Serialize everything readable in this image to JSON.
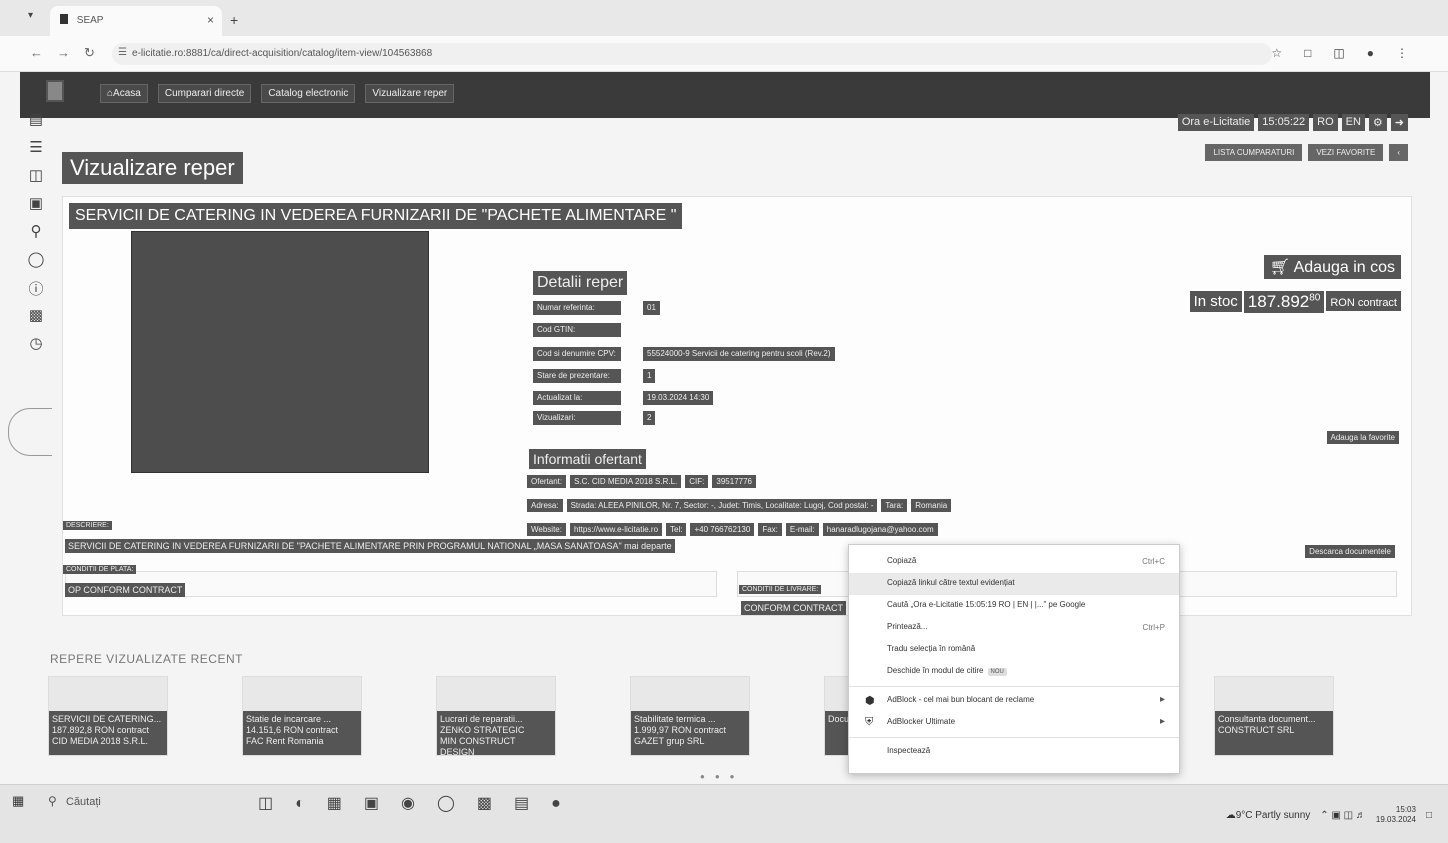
{
  "browser": {
    "tab_title": "SEAP",
    "url": "e-licitatie.ro:8881/ca/direct-acquisition/catalog/item-view/104563868"
  },
  "nav": {
    "crumbs": [
      "Acasa",
      "Cumparari directe",
      "Catalog electronic",
      "Vizualizare reper"
    ]
  },
  "header": {
    "time_label": "Ora e-Licitatie",
    "time_value": "15:05:22",
    "lang_ro": "RO",
    "lang_en": "EN",
    "cart_btn": "LISTA CUMPARATURI",
    "fav_btn": "VEZI FAVORITE"
  },
  "page": {
    "title": "Vizualizare reper"
  },
  "item": {
    "title": "SERVICII DE CATERING IN VEDEREA FURNIZARII DE \"PACHETE ALIMENTARE \"",
    "details_heading": "Detalii reper",
    "details": [
      {
        "label": "Numar referinta:",
        "value": "01"
      },
      {
        "label": "Cod GTIN:",
        "value": ""
      },
      {
        "label": "Cod si denumire CPV:",
        "value": "55524000-9 Servicii de catering pentru scoli (Rev.2)"
      },
      {
        "label": "Stare de prezentare:",
        "value": "1"
      },
      {
        "label": "Actualizat la:",
        "value": "19.03.2024 14:30"
      },
      {
        "label": "Vizualizari:",
        "value": "2"
      }
    ],
    "ofertant_heading": "Informatii ofertant",
    "ofertant": {
      "ofertant_lbl": "Ofertant:",
      "ofertant_val": "S.C. CID MEDIA 2018 S.R.L.",
      "cif_lbl": "CIF:",
      "cif_val": "39517776",
      "adresa_lbl": "Adresa:",
      "adresa_val": "Strada: ALEEA PINILOR, Nr. 7, Sector: -, Judet: Timis, Localitate: Lugoj, Cod postal: -",
      "tara_lbl": "Tara:",
      "tara_val": "Romania",
      "website_lbl": "Website:",
      "website_val": "https://www.e-licitatie.ro",
      "tel_lbl": "Tel:",
      "tel_val": "+40 766762130",
      "fax_lbl": "Fax:",
      "fax_val": "",
      "email_lbl": "E-mail:",
      "email_val": "hanaradlugojana@yahoo.com"
    },
    "add_to_cart": "Adauga in cos",
    "in_stock": "In stoc",
    "price_main": "187.892",
    "price_dec": "80",
    "price_unit": "RON contract",
    "add_fav": "Adauga la favorite",
    "download_docs": "Descarca documentele",
    "desc_label": "DESCRIERE:",
    "desc_value": "SERVICII DE CATERING IN VEDEREA FURNIZARII DE \"PACHETE ALIMENTARE PRIN PROGRAMUL NATIONAL „MASA SANATOASA\" mai departe",
    "payment_label": "CONDITII DE PLATA:",
    "payment_value": "OP CONFORM CONTRACT",
    "delivery_label": "CONDITII DE LIVRARE:",
    "delivery_value": "CONFORM CONTRACT"
  },
  "recent": {
    "heading": "REPERE VIZUALIZATE RECENT",
    "cards": [
      {
        "title": "SERVICII DE CATERING...",
        "line2": "187.892,8 RON contract",
        "line3": "CID MEDIA 2018 S.R.L."
      },
      {
        "title": "Statie de incarcare ...",
        "line2": "14.151,6 RON contract",
        "line3": "FAC Rent Romania"
      },
      {
        "title": "Lucrari de reparatii...",
        "line2": "ZENKO STRATEGIC",
        "line3": "MIN CONSTRUCT DESIGN"
      },
      {
        "title": "Stabilitate termica ...",
        "line2": "1.999,97 RON contract",
        "line3": "GAZET grup SRL"
      },
      {
        "title": "Documentatii ...",
        "line2": "",
        "line3": ""
      },
      {
        "title": "Consultanta document...",
        "line2": "",
        "line3": "CONSTRUCT SRL"
      }
    ]
  },
  "context_menu": {
    "items": [
      {
        "label": "Copiază",
        "shortcut": "Ctrl+C"
      },
      {
        "label": "Copiază linkul către textul evidențiat",
        "shortcut": ""
      },
      {
        "label": "Caută „Ora e-Licitatie 15:05:19 RO | EN | |...” pe Google",
        "shortcut": ""
      },
      {
        "label": "Printează...",
        "shortcut": "Ctrl+P"
      },
      {
        "label": "Tradu selecția în română",
        "shortcut": ""
      },
      {
        "label": "Deschide în modul de citire",
        "shortcut": "",
        "badge": "NOU"
      },
      {
        "label": "AdBlock - cel mai bun blocant de reclame",
        "shortcut": ""
      },
      {
        "label": "AdBlocker Ultimate",
        "shortcut": ""
      },
      {
        "label": "Inspectează",
        "shortcut": ""
      }
    ]
  },
  "taskbar": {
    "search_placeholder": "Căutați",
    "weather": "9°C Partly sunny",
    "time": "15:03",
    "date": "19.03.2024"
  }
}
